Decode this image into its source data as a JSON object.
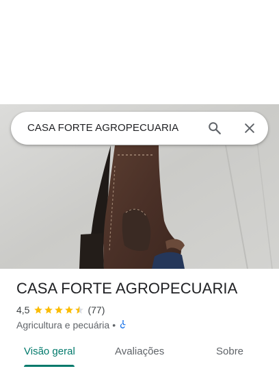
{
  "search": {
    "query": "CASA FORTE AGROPECUARIA"
  },
  "place": {
    "name": "CASA FORTE AGROPECUARIA",
    "rating": "4,5",
    "stars": 4.5,
    "review_count": "(77)",
    "category": "Agricultura e pecuária",
    "separator": "•",
    "accessibility_icon": "wheelchair-icon"
  },
  "tabs": [
    {
      "label": "Visão geral",
      "active": true
    },
    {
      "label": "Avaliações",
      "active": false
    },
    {
      "label": "Sobre",
      "active": false
    }
  ],
  "colors": {
    "accent": "#00796b",
    "star": "#fbbc04",
    "accessibility": "#1a73e8"
  }
}
